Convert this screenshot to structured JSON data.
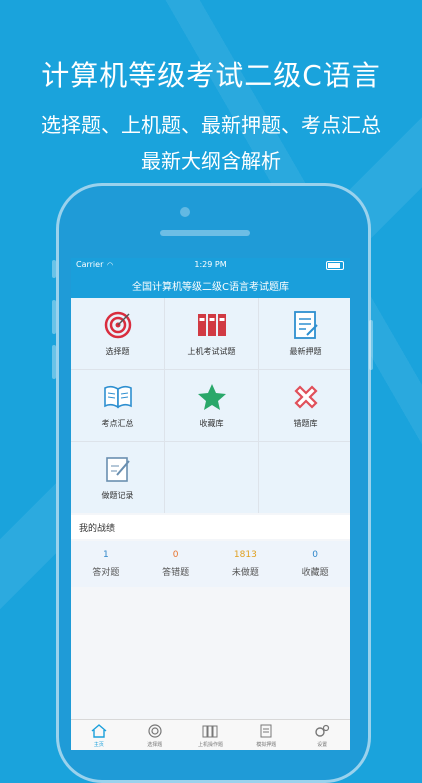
{
  "promo": {
    "title": "计算机等级考试二级C语言",
    "line1": "选择题、上机题、最新押题、考点汇总",
    "line2": "最新大纲含解析"
  },
  "statusbar": {
    "carrier": "Carrier",
    "time": "1:29 PM"
  },
  "navbar": {
    "title": "全国计算机等级二级C语言考试题库"
  },
  "grid": [
    {
      "label": "选择题",
      "icon": "target-icon"
    },
    {
      "label": "上机考试试题",
      "icon": "binders-icon"
    },
    {
      "label": "最新押题",
      "icon": "document-edit-icon"
    },
    {
      "label": "考点汇总",
      "icon": "open-book-icon"
    },
    {
      "label": "收藏库",
      "icon": "star-icon"
    },
    {
      "label": "错题库",
      "icon": "cross-icon"
    },
    {
      "label": "做题记录",
      "icon": "record-icon"
    }
  ],
  "section": {
    "title": "我的战绩"
  },
  "stats": [
    {
      "value": "1",
      "label": "答对题",
      "color": "#2f86c9"
    },
    {
      "value": "0",
      "label": "答错题",
      "color": "#e8742f"
    },
    {
      "value": "1813",
      "label": "未做题",
      "color": "#e0a020"
    },
    {
      "value": "0",
      "label": "收藏题",
      "color": "#2f86c9"
    }
  ],
  "tabs": [
    {
      "label": "主页",
      "icon": "home-icon",
      "active": true
    },
    {
      "label": "选择题",
      "icon": "target-icon"
    },
    {
      "label": "上机操作题",
      "icon": "binders-icon"
    },
    {
      "label": "模拟押题",
      "icon": "document-icon"
    },
    {
      "label": "设置",
      "icon": "gear-icon"
    }
  ],
  "colors": {
    "accent": "#1a9fdb",
    "background": "#1aa3dc"
  }
}
